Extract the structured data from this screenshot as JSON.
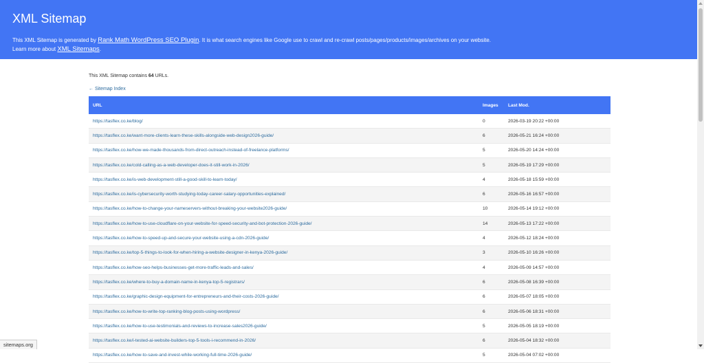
{
  "header": {
    "title": "XML Sitemap",
    "desc_before": "This XML Sitemap is generated by ",
    "plugin_link": "Rank Math WordPress SEO Plugin",
    "desc_after": ". It is what search engines like Google use to crawl and re-crawl posts/pages/products/images/archives on your website.",
    "learn_before": "Learn more about ",
    "learn_link": "XML Sitemaps",
    "learn_after": "."
  },
  "intro": {
    "before": "This XML Sitemap contains ",
    "count": "64",
    "after": " URLs."
  },
  "back_link": "← Sitemap Index",
  "table": {
    "headers": {
      "url": "URL",
      "images": "Images",
      "lastmod": "Last Mod."
    },
    "rows": [
      {
        "url": "https://tasflex.co.ke/blog/",
        "images": "0",
        "lastmod": "2026-03-19 20:22 +00:00"
      },
      {
        "url": "https://tasflex.co.ke/want-more-clients-learn-these-skills-alongside-web-design2026-guide/",
        "images": "6",
        "lastmod": "2026-05-21 16:24 +00:00"
      },
      {
        "url": "https://tasflex.co.ke/how-we-made-thousands-from-direct-outreach-instead-of-freelance-platforms/",
        "images": "5",
        "lastmod": "2026-05-20 14:24 +00:00"
      },
      {
        "url": "https://tasflex.co.ke/cold-calling-as-a-web-developer-does-it-still-work-in-2026/",
        "images": "5",
        "lastmod": "2026-05-19 17:29 +00:00"
      },
      {
        "url": "https://tasflex.co.ke/is-web-development-still-a-good-skill-to-learn-today/",
        "images": "4",
        "lastmod": "2026-05-18 15:59 +00:00"
      },
      {
        "url": "https://tasflex.co.ke/is-cybersecurity-worth-studying-today-career-salary-opportunities-explained/",
        "images": "6",
        "lastmod": "2026-05-16 16:57 +00:00"
      },
      {
        "url": "https://tasflex.co.ke/how-to-change-your-nameservers-without-breaking-your-website2026-guide/",
        "images": "10",
        "lastmod": "2026-05-14 19:12 +00:00"
      },
      {
        "url": "https://tasflex.co.ke/how-to-use-cloudflare-on-your-website-for-speed-security-and-bot-protection-2026-guide/",
        "images": "14",
        "lastmod": "2026-05-13 17:22 +00:00"
      },
      {
        "url": "https://tasflex.co.ke/how-to-speed-up-and-secure-your-website-using-a-cdn-2026-guide/",
        "images": "4",
        "lastmod": "2026-05-12 18:24 +00:00"
      },
      {
        "url": "https://tasflex.co.ke/top-5-things-to-look-for-when-hiring-a-website-designer-in-kenya-2026-guide/",
        "images": "3",
        "lastmod": "2026-05-10 16:26 +00:00"
      },
      {
        "url": "https://tasflex.co.ke/how-seo-helps-businesses-get-more-traffic-leads-and-sales/",
        "images": "4",
        "lastmod": "2026-05-09 14:57 +00:00"
      },
      {
        "url": "https://tasflex.co.ke/where-to-buy-a-domain-name-in-kenya-top-5-registrars/",
        "images": "6",
        "lastmod": "2026-05-08 16:39 +00:00"
      },
      {
        "url": "https://tasflex.co.ke/graphic-design-equipment-for-entrepreneurs-and-their-costs-2026-guide/",
        "images": "6",
        "lastmod": "2026-05-07 18:05 +00:00"
      },
      {
        "url": "https://tasflex.co.ke/how-to-write-top-ranking-blog-posts-using-wordpress/",
        "images": "6",
        "lastmod": "2026-05-06 18:31 +00:00"
      },
      {
        "url": "https://tasflex.co.ke/how-to-use-testimonials-and-reviews-to-increase-sales2026-guide/",
        "images": "5",
        "lastmod": "2026-05-05 18:19 +00:00"
      },
      {
        "url": "https://tasflex.co.ke/i-tested-ai-website-builders-top-5-tools-i-recommend-in-2026/",
        "images": "6",
        "lastmod": "2026-05-04 18:32 +00:00"
      },
      {
        "url": "https://tasflex.co.ke/how-to-save-and-invest-while-working-full-time-2026-guide/",
        "images": "5",
        "lastmod": "2026-05-04 07:02 +00:00"
      }
    ]
  },
  "status_bar": "sitemaps.org",
  "colors": {
    "header_bg": "#4275f4",
    "link": "#2c6b9e",
    "row_alt": "#f4f4f4"
  }
}
